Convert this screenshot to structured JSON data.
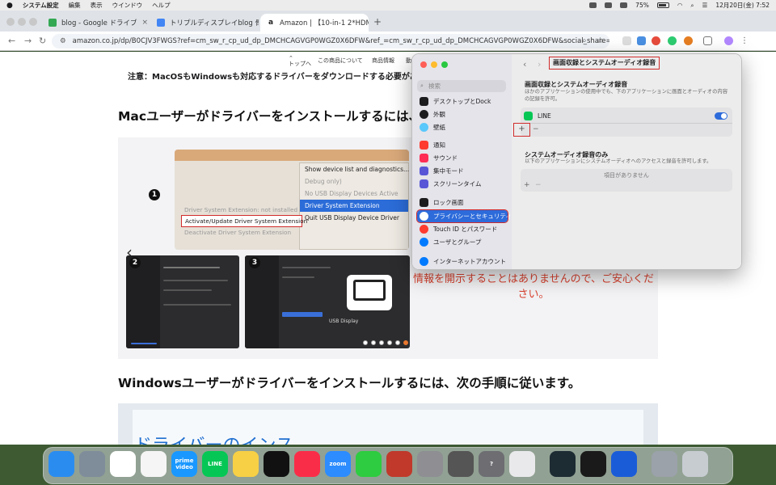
{
  "menubar": {
    "apple": "",
    "items": [
      "システム設定",
      "編集",
      "表示",
      "ウインドウ",
      "ヘルプ"
    ],
    "battery": "75%",
    "datetime": "12月20日(金)  7:52"
  },
  "browser": {
    "tabs": [
      {
        "title": "blog - Google ドライブ",
        "color": "#34a853"
      },
      {
        "title": "トリプルディスプレイblog 骨格",
        "color": "#4285f4"
      },
      {
        "title": "Amazon | 【10-in-1 2*HDMI ハ",
        "color": "#222222"
      }
    ],
    "new_tab": "+",
    "url": "amazon.co.jp/dp/B0CJV3FWGS?ref=cm_sw_r_cp_ud_dp_DMCHCAGVGP0WGZ0X6DFW&ref_=cm_sw_r_cp_ud_dp_DMCHCAGVGP0WGZ0X6DFW&social_share=..."
  },
  "page": {
    "subnav": {
      "top": "トップへ",
      "about": "この商品について",
      "info": "商品情報",
      "more": "動"
    },
    "note": "注意：MacOSもWindowsも対応するドライバーをダウンロードする必要があります",
    "heading_mac": "Macユーザーがドライバーをインストールするには、次",
    "heading_win": "Windowsユーザーがドライバーをインストールするには、次の手順に従います。",
    "promo": "情報を開示することはありませんので、ご安心ください。",
    "banner_text": "ドライバーのインス",
    "step_numbers": [
      "1",
      "2",
      "3"
    ],
    "shot1": {
      "dropdown": [
        "Show device list and diagnostics...",
        "Debug only)",
        "No USB Display Devices Active",
        "Driver System Extension",
        "Quit USB Display Device Driver"
      ],
      "submenu": [
        "Driver System Extension: not installed",
        "Activate/Update Driver System Extension",
        "Deactivate Driver System Extension"
      ]
    },
    "shot3": {
      "title": "USB Display"
    }
  },
  "settings": {
    "search_placeholder": "検索",
    "sidebar": [
      {
        "label": "デスクトップとDock",
        "color": "#1c1c1e"
      },
      {
        "label": "外観",
        "color": "#1c1c1e"
      },
      {
        "label": "壁紙",
        "color": "#5ac8fa"
      },
      {
        "label": "通知",
        "color": "#ff3b30"
      },
      {
        "label": "サウンド",
        "color": "#ff2d55"
      },
      {
        "label": "集中モード",
        "color": "#5856d6"
      },
      {
        "label": "スクリーンタイム",
        "color": "#5856d6"
      },
      {
        "label": "ロック画面",
        "color": "#1c1c1e"
      },
      {
        "label": "プライバシーとセキュリティ",
        "color": "#2d6bdb"
      },
      {
        "label": "Touch ID とパスワード",
        "color": "#ff3b30"
      },
      {
        "label": "ユーザとグループ",
        "color": "#007aff"
      },
      {
        "label": "インターネットアカウント",
        "color": "#007aff"
      }
    ],
    "title": "画面収録とシステムオーディオ録音",
    "section1": {
      "heading": "画面収録とシステムオーディオ録音",
      "desc": "ほかのアプリケーションの使用中でも、下のアプリケーションに画面とオーディオの内容の記録を許可。",
      "apps": [
        {
          "name": "LINE",
          "enabled": true
        }
      ]
    },
    "section2": {
      "heading": "システムオーディオ録音のみ",
      "desc": "以下のアプリケーションにシステムオーディオへのアクセスと録音を許可します。",
      "empty": "項目がありません"
    },
    "plus": "+",
    "minus": "−"
  },
  "dock": {
    "apps": [
      {
        "name": "Finder",
        "label": "",
        "color": "#2b8cf0"
      },
      {
        "name": "Launchpad",
        "label": "",
        "color": "#7f8c9a"
      },
      {
        "name": "Chrome",
        "label": "",
        "color": "#ffffff"
      },
      {
        "name": "Photos",
        "label": "",
        "color": "#f5f5f5"
      },
      {
        "name": "Prime Video",
        "label": "prime video",
        "color": "#1a98ff"
      },
      {
        "name": "LINE",
        "label": "LINE",
        "color": "#06c755"
      },
      {
        "name": "Notes",
        "label": "",
        "color": "#f7d046"
      },
      {
        "name": "Clock",
        "label": "",
        "color": "#111111"
      },
      {
        "name": "Music",
        "label": "",
        "color": "#fa2d48"
      },
      {
        "name": "Zoom",
        "label": "zoom",
        "color": "#2d8cff"
      },
      {
        "name": "FaceTime",
        "label": "",
        "color": "#2ecc40"
      },
      {
        "name": "Mouse",
        "label": "",
        "color": "#c0392b"
      },
      {
        "name": "System Settings",
        "label": "",
        "color": "#8e8e93"
      },
      {
        "name": "Calculator",
        "label": "",
        "color": "#555555"
      },
      {
        "name": "Help",
        "label": "?",
        "color": "#6d6d72"
      },
      {
        "name": "iPhone Mirroring",
        "label": "",
        "color": "#e9e9eb"
      },
      {
        "name": "Filmora",
        "label": "",
        "color": "#1d2b33"
      },
      {
        "name": "QuickTime",
        "label": "",
        "color": "#1a1a1a"
      },
      {
        "name": "1Password",
        "label": "",
        "color": "#1a5cd8"
      },
      {
        "name": "Downloads",
        "label": "",
        "color": "#9ba2aa"
      },
      {
        "name": "Trash",
        "label": "",
        "color": "#c7ccd1"
      }
    ]
  }
}
